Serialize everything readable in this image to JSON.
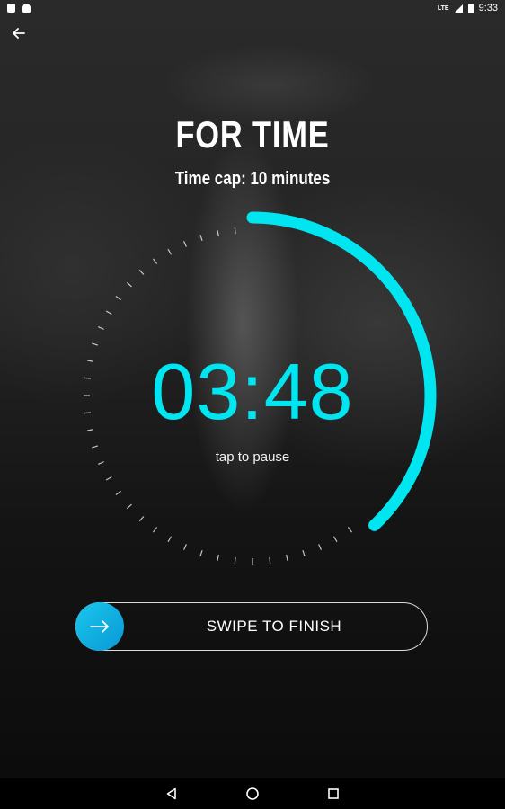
{
  "status_bar": {
    "time": "9:33",
    "network": "LTE",
    "icons": [
      "notification-icon",
      "android-icon",
      "signal-icon",
      "battery-icon"
    ]
  },
  "header": {
    "back_icon": "arrow-left-icon"
  },
  "workout": {
    "title": "FOR TIME",
    "subtitle": "Time cap: 10 minutes"
  },
  "timer": {
    "display": "03:48",
    "hint": "tap to pause",
    "progress": 0.38,
    "accent_color": "#00e5f0"
  },
  "swipe": {
    "label": "SWIPE TO FINISH",
    "knob_icon": "arrow-right-icon"
  },
  "nav_bar": {
    "icons": [
      "back-triangle-icon",
      "home-circle-icon",
      "recents-square-icon"
    ]
  }
}
